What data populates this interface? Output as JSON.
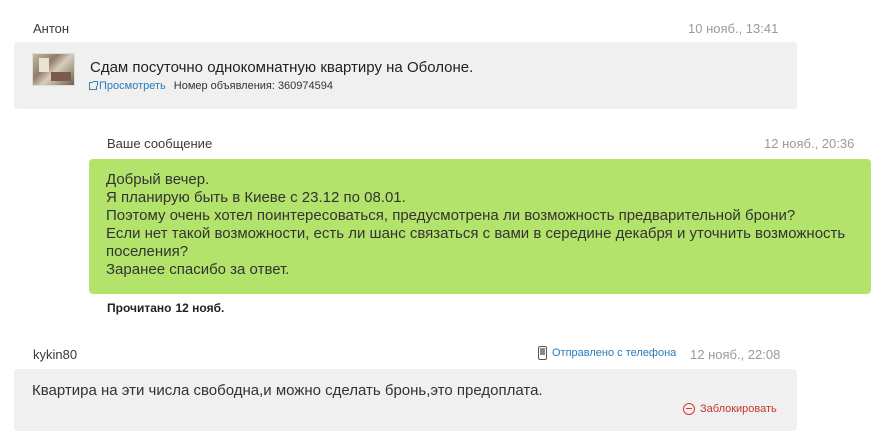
{
  "messages": [
    {
      "author": "Антон",
      "time": "10 нояб., 13:41",
      "ad": {
        "title": "Сдам посуточно однокомнатную квартиру на Оболоне.",
        "view_link": "Просмотреть",
        "number_label": "Номер объявления:",
        "number": "360974594"
      }
    },
    {
      "author": "Ваше сообщение",
      "time": "12 нояб., 20:36",
      "lines": [
        "Добрый вечер.",
        "Я планирую быть в Киеве с 23.12 по 08.01.",
        "Поэтому очень хотел поинтересоваться, предусмотрена ли возможность предварительной брони?",
        "Если нет такой возможности, есть ли шанс связаться с вами в середине декабря и уточнить возможность",
        "поселения?",
        "Заранее спасибо за ответ."
      ],
      "read_label": "Прочитано",
      "read_date": "12 нояб."
    },
    {
      "author": "kykin80",
      "sent_from": "Отправлено с телефона",
      "time": "12 нояб., 22:08",
      "text": "Квартира на эти числа свободна,и можно сделать бронь,это предоплата.",
      "block_label": "Заблокировать"
    }
  ],
  "colors": {
    "outgoing_bubble": "#b3e36b",
    "incoming_bubble": "#f0f0f0",
    "link": "#2a7ab8",
    "block": "#d23a2a"
  },
  "icons": [
    "external-link-icon",
    "phone-icon",
    "block-icon"
  ]
}
